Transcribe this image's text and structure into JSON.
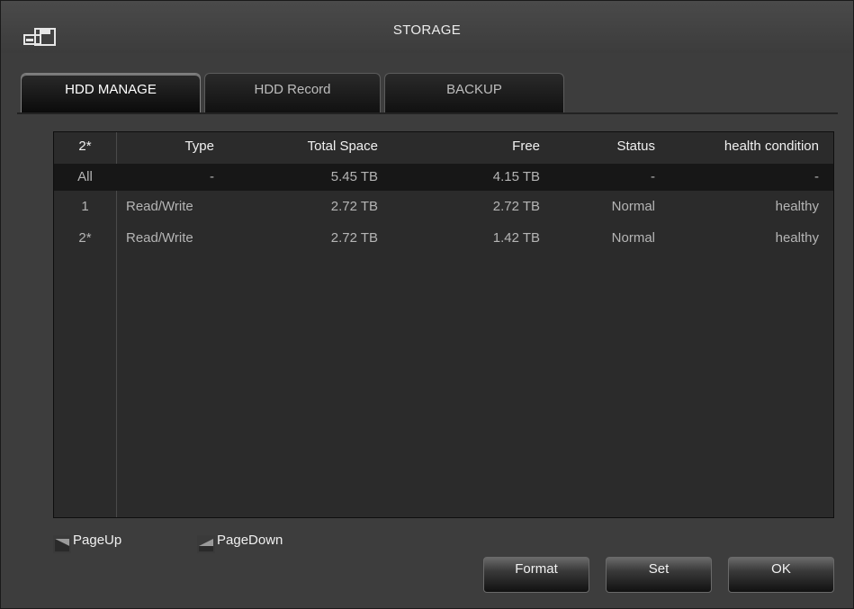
{
  "window": {
    "title": "STORAGE",
    "icon": "storage-disk-icon"
  },
  "tabs": [
    {
      "label": "HDD MANAGE",
      "active": true
    },
    {
      "label": "HDD Record",
      "active": false
    },
    {
      "label": "BACKUP",
      "active": false
    }
  ],
  "table": {
    "columns": [
      "2*",
      "Type",
      "Total Space",
      "Free",
      "Status",
      "health condition"
    ],
    "rows": [
      {
        "id": "All",
        "type": "-",
        "total": "5.45 TB",
        "free": "4.15 TB",
        "status": "-",
        "health": "-"
      },
      {
        "id": "1",
        "type": "Read/Write",
        "total": "2.72 TB",
        "free": "2.72 TB",
        "status": "Normal",
        "health": "healthy"
      },
      {
        "id": "2*",
        "type": "Read/Write",
        "total": "2.72 TB",
        "free": "1.42 TB",
        "status": "Normal",
        "health": "healthy"
      }
    ]
  },
  "pager": {
    "page_up": "PageUp",
    "page_down": "PageDown"
  },
  "buttons": {
    "format": "Format",
    "set": "Set",
    "ok": "OK"
  },
  "colors": {
    "background": "#3d3d3d",
    "table_bg": "#2b2b2b",
    "selected_row": "#171717"
  }
}
